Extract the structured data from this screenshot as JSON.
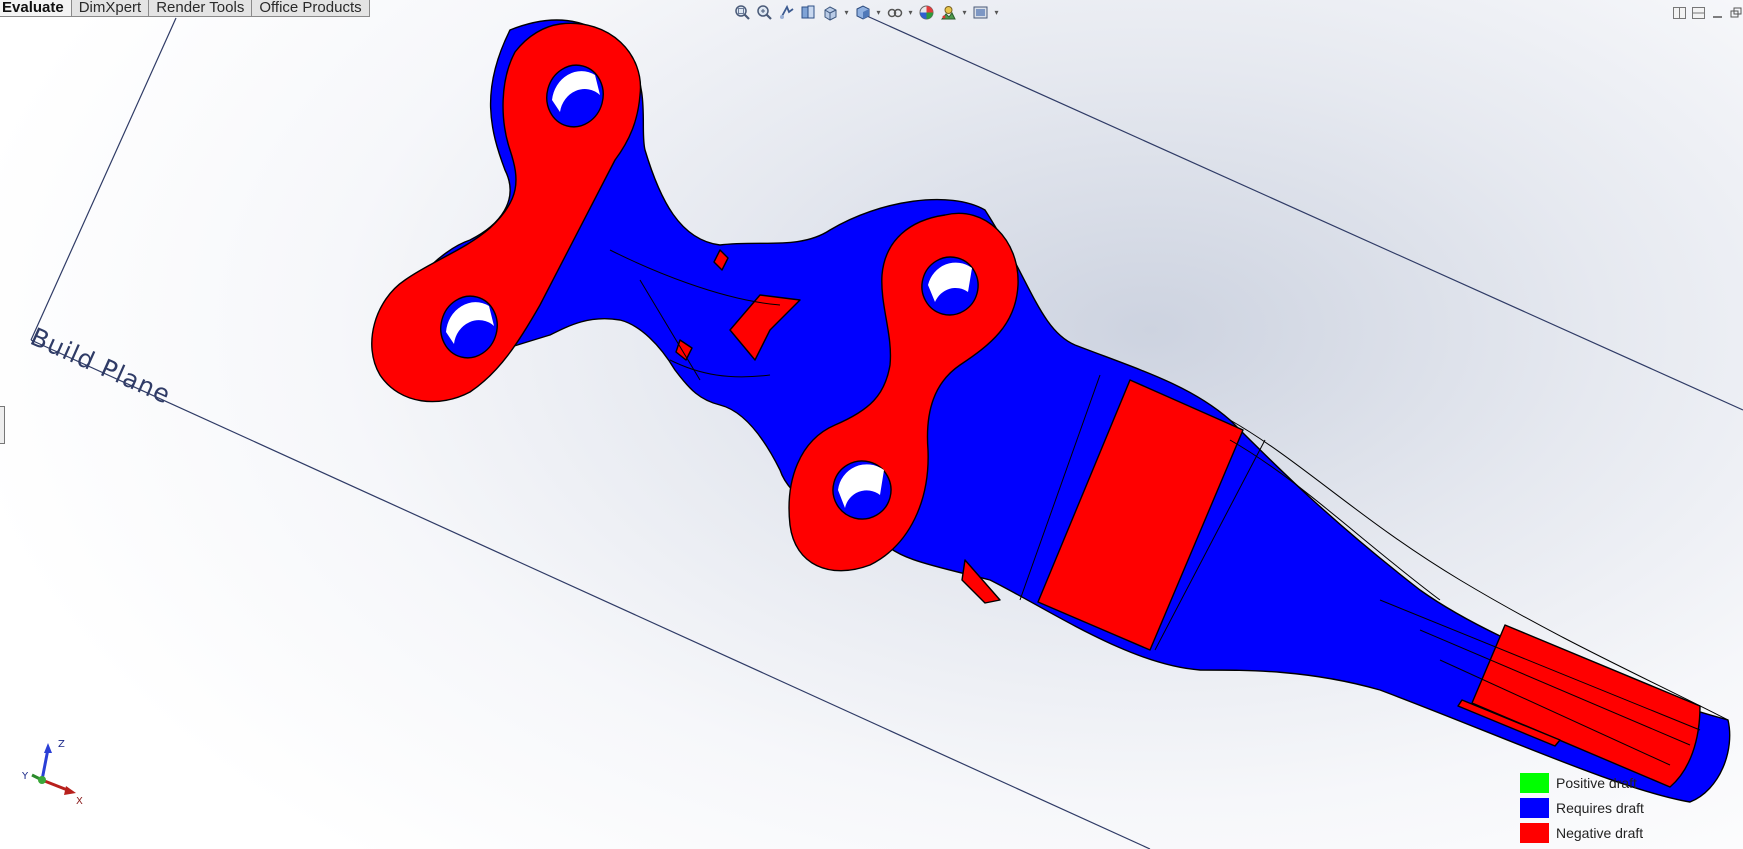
{
  "tabs": [
    {
      "label": "Evaluate",
      "active": true
    },
    {
      "label": "DimXpert",
      "active": false
    },
    {
      "label": "Render Tools",
      "active": false
    },
    {
      "label": "Office Products",
      "active": false
    }
  ],
  "toolbar_icons": [
    "zoom-to-fit-icon",
    "zoom-to-area-icon",
    "previous-view-icon",
    "section-view-icon",
    "view-orientation-icon",
    "display-style-icon",
    "hide-show-items-icon",
    "edit-appearance-icon",
    "apply-scene-icon",
    "view-settings-icon"
  ],
  "scene": {
    "build_plane_label": "Build Plane"
  },
  "triad": {
    "x_label": "X",
    "y_label": "Y",
    "z_label": "Z"
  },
  "legend": [
    {
      "label": "Positive draft",
      "color": "#00ff00"
    },
    {
      "label": "Requires draft",
      "color": "#0000ff"
    },
    {
      "label": "Negative draft",
      "color": "#ff0000"
    }
  ],
  "colors": {
    "requires_draft": "#0000ff",
    "negative_draft": "#ff0000",
    "plane_line": "#2f3b66"
  }
}
